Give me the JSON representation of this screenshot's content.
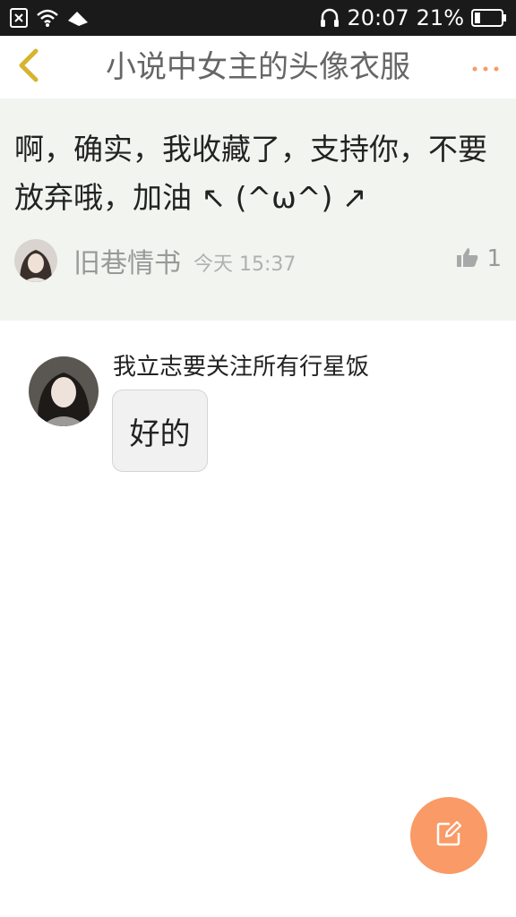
{
  "status_bar": {
    "time": "20:07",
    "battery_percent": "21%",
    "battery_level": 0.21,
    "icons": [
      "sim-off-icon",
      "wifi-icon",
      "signal-icon",
      "headphones-icon",
      "battery-icon"
    ]
  },
  "header": {
    "title": "小说中女主的头像衣服",
    "back_icon": "chevron-left-icon",
    "more_icon": "more-dots-icon",
    "accent_color": "#fa9a67"
  },
  "original_comment": {
    "text": "啊，确实，我收藏了，支持你，不要放弃哦，加油 ↖ (^ω^) ↗",
    "author": "旧巷情书",
    "time": "今天 15:37",
    "likes": "1"
  },
  "reply": {
    "author": "我立志要关注所有行星饭",
    "text": "好的"
  },
  "fab": {
    "icon": "edit-icon",
    "color": "#fa9a67"
  }
}
